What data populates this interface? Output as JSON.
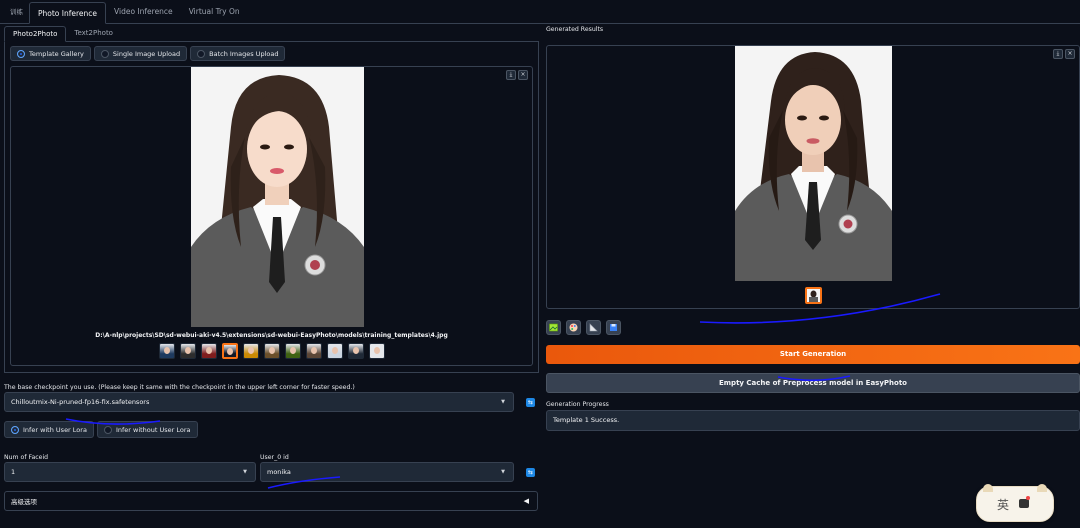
{
  "top_tabs": [
    {
      "label": "训练",
      "active": false
    },
    {
      "label": "Photo Inference",
      "active": true
    },
    {
      "label": "Video Inference",
      "active": false
    },
    {
      "label": "Virtual Try On",
      "active": false
    }
  ],
  "sub_tabs": [
    {
      "label": "Photo2Photo",
      "active": true
    },
    {
      "label": "Text2Photo",
      "active": false
    }
  ],
  "upload_mode": {
    "options": [
      "Template Gallery",
      "Single Image Upload",
      "Batch Images Upload"
    ],
    "selected": "Template Gallery"
  },
  "gallery": {
    "caption": "D:\\A-nlp\\projects\\SD\\sd-webui-aki-v4.5\\extensions\\sd-webui-EasyPhoto\\models\\training_templates\\4.jpg",
    "thumbnail_count": 11,
    "selected_index": 3,
    "download_icon": "⤓",
    "close_icon": "×"
  },
  "checkpoint": {
    "label": "The base checkpoint you use. (Please keep it same with the checkpoint in the upper left corner for faster speed.)",
    "value": "Chilloutmix-Ni-pruned-fp16-fix.safetensors"
  },
  "lora_mode": {
    "options": [
      "Infer with User Lora",
      "Infer without User Lora"
    ],
    "selected": "Infer with User Lora"
  },
  "num_faceid": {
    "label": "Num of Faceid",
    "value": "1"
  },
  "user_id": {
    "label": "User_0 id",
    "value": "monika"
  },
  "advanced": {
    "label": "高级选项",
    "icon": "◀"
  },
  "results": {
    "label": "Generated Results",
    "download_icon": "⤓",
    "close_icon": "×"
  },
  "buttons": {
    "start": "Start Generation",
    "empty_cache": "Empty Cache of Preprocess model in EasyPhoto"
  },
  "progress": {
    "label": "Generation Progress",
    "value": "Template 1 Success."
  },
  "ime": {
    "char": "英"
  },
  "colors": {
    "accent": "#f97316",
    "radio_on": "#2563eb",
    "refresh": "#1e88e5",
    "annotation_stroke": "#1a1aff"
  }
}
